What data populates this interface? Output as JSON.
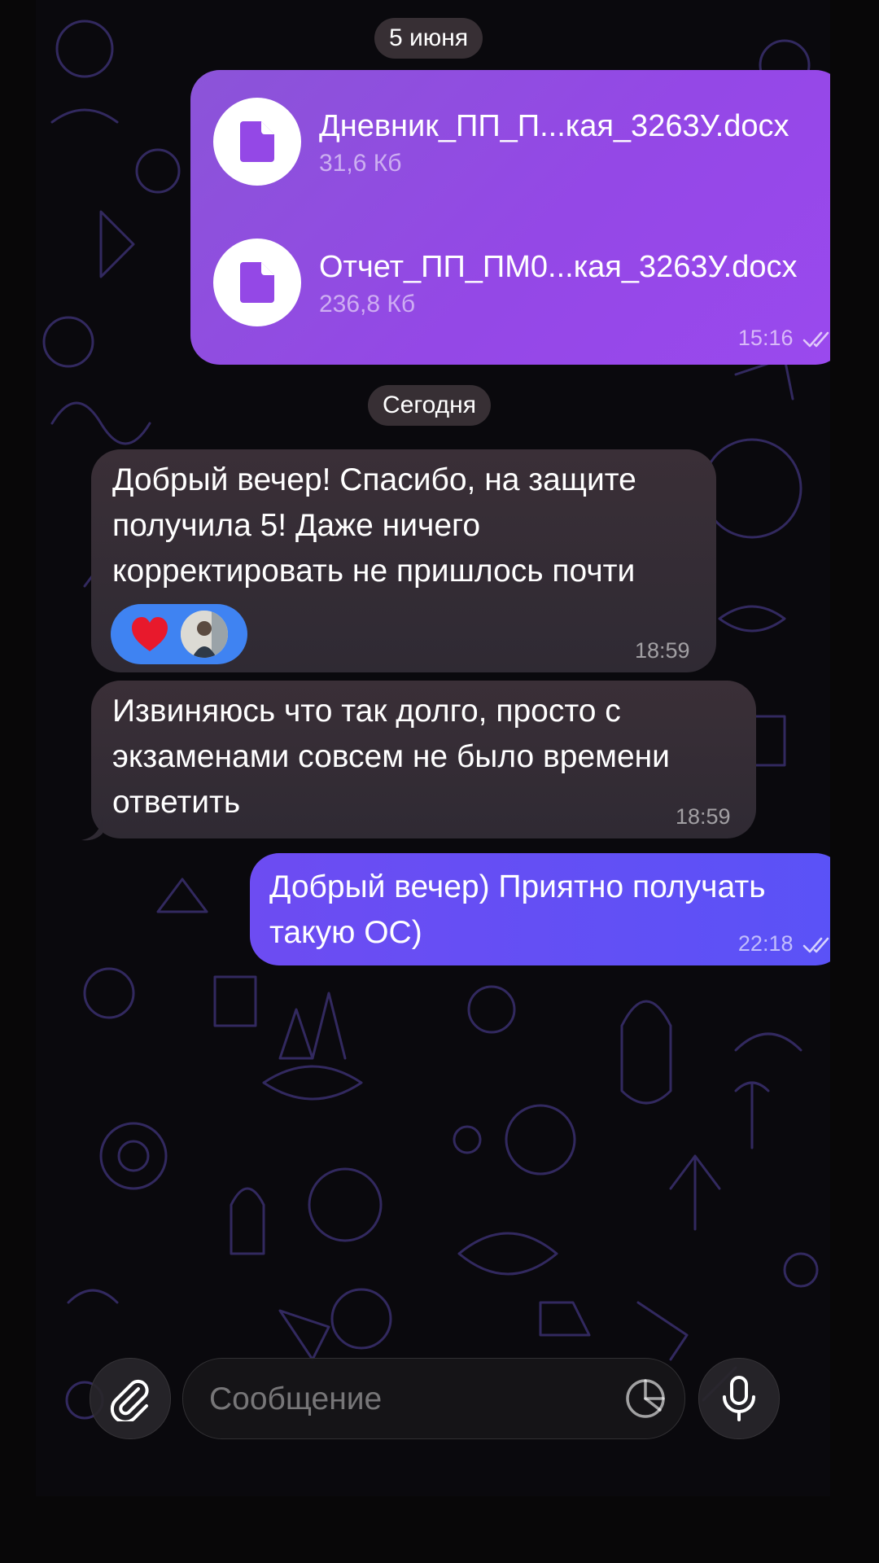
{
  "date_separators": {
    "first": "5 июня",
    "second": "Сегодня"
  },
  "outgoing_files": {
    "files": [
      {
        "name": "Дневник_ПП_П...кая_3263У.docx",
        "size": "31,6 Кб",
        "icon": "document-icon"
      },
      {
        "name": "Отчет_ПП_ПМ0...кая_3263У.docx",
        "size": "236,8 Кб",
        "icon": "document-icon"
      }
    ],
    "time": "15:16",
    "status": "read"
  },
  "incoming_messages": [
    {
      "lines": [
        "Добрый вечер! Спасибо, на защите",
        "получила 5! Даже ничего",
        "корректировать не пришлось почти"
      ],
      "time": "18:59",
      "reactions": [
        "heart",
        "avatar"
      ]
    },
    {
      "lines": [
        "Извиняюсь что так долго, просто с",
        "экзаменами совсем не было времени",
        "ответить"
      ],
      "time": "18:59"
    }
  ],
  "outgoing_text": {
    "lines": [
      "Добрый вечер) Приятно получать",
      "такую ОС)"
    ],
    "time": "22:18",
    "status": "read"
  },
  "input": {
    "placeholder": "Сообщение",
    "value": ""
  },
  "colors": {
    "outgoing_file_bubble": "#9448e6",
    "outgoing_text_bubble": "#6350f5",
    "incoming_bubble": "#342c35",
    "reaction_chip": "#3f83f2",
    "wallpaper_doodles": "#3a2f6e"
  },
  "icons": {
    "attach": "paperclip-icon",
    "sticker": "sticker-icon",
    "mic": "microphone-icon",
    "read_status": "double-check-icon",
    "reaction": "heart-icon"
  }
}
